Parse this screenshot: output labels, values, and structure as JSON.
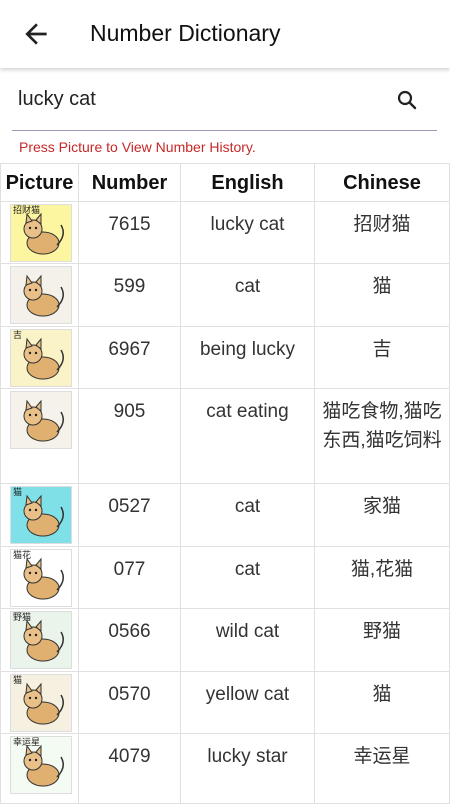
{
  "header": {
    "title": "Number Dictionary",
    "back_icon": "arrow-left-icon"
  },
  "search": {
    "value": "lucky cat",
    "icon": "search-icon"
  },
  "hint": "Press Picture to View Number History.",
  "table": {
    "columns": [
      "Picture",
      "Number",
      "English",
      "Chinese"
    ],
    "rows": [
      {
        "picture_caption": "招财猫",
        "number": "7615",
        "english": "lucky cat",
        "chinese": "招财猫"
      },
      {
        "picture_caption": "",
        "number": "599",
        "english": "cat",
        "chinese": "猫"
      },
      {
        "picture_caption": "吉",
        "number": "6967",
        "english": "being lucky",
        "chinese": "吉"
      },
      {
        "picture_caption": "",
        "number": "905",
        "english": "cat eating",
        "chinese": "猫吃食物,猫吃东西,猫吃饲料"
      },
      {
        "picture_caption": "猫",
        "number": "0527",
        "english": "cat",
        "chinese": "家猫"
      },
      {
        "picture_caption": "猫花",
        "number": "077",
        "english": "cat",
        "chinese": "猫,花猫"
      },
      {
        "picture_caption": "野猫",
        "number": "0566",
        "english": "wild cat",
        "chinese": "野猫"
      },
      {
        "picture_caption": "猫",
        "number": "0570",
        "english": "yellow cat",
        "chinese": "猫"
      },
      {
        "picture_caption": "幸运星",
        "number": "4079",
        "english": "lucky star",
        "chinese": "幸运星"
      }
    ]
  },
  "colors": {
    "accent_error": "#c62828",
    "underline": "#9e97b8"
  }
}
